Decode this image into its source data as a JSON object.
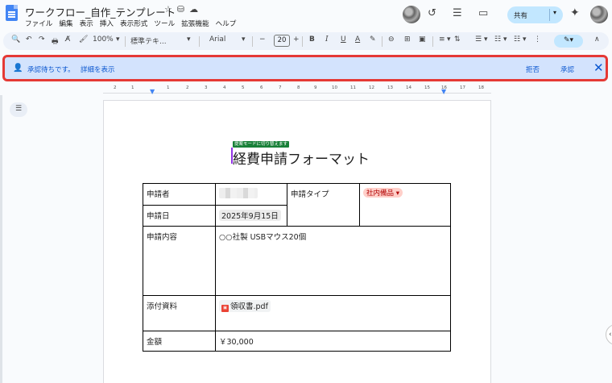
{
  "header": {
    "doc_title": "ワークフロー_自作_テンプレート",
    "title_icons": [
      "☆",
      "⛁",
      "☁"
    ],
    "menu": [
      "ファイル",
      "編集",
      "表示",
      "挿入",
      "表示形式",
      "ツール",
      "拡張機能",
      "ヘルプ"
    ],
    "share_label": "共有",
    "icons": {
      "history": "↺",
      "comments": "☰",
      "meet": "▭",
      "gemini": "✦"
    }
  },
  "toolbar": {
    "search": "🔍",
    "undo": "↶",
    "redo": "↷",
    "print": "🖶",
    "spell": "A̸",
    "paint": "🖌",
    "zoom": "100%",
    "style": "標準テキ...",
    "font": "Arial",
    "font_size": "20",
    "minus": "−",
    "plus": "+",
    "bold": "B",
    "italic": "I",
    "underline": "U",
    "text_color": "A",
    "highlight": "✎",
    "link": "⊖",
    "comment": "⊞",
    "image": "▣",
    "align": "≡",
    "line_spacing": "⇅",
    "checklist": "☰",
    "bullets": "☷",
    "numbering": "☷",
    "more": "⋮",
    "edit_mode": "✎▾",
    "collapse": "∧"
  },
  "approval": {
    "icon": "👤",
    "message": "承認待ちです。",
    "detail_link": "詳細を表示",
    "reject": "拒否",
    "approve": "承認",
    "close": "✕"
  },
  "ruler": {
    "ticks": [
      "2",
      "1",
      "1",
      "2",
      "3",
      "4",
      "5",
      "6",
      "7",
      "8",
      "9",
      "10",
      "11",
      "12",
      "13",
      "14",
      "15",
      "16",
      "17",
      "18"
    ]
  },
  "outline_icon": "☰",
  "document": {
    "mode_tag": "提案モードに切り替えます",
    "heading": "経費申請フォーマット",
    "rows": {
      "applicant_label": "申請者",
      "type_label": "申請タイプ",
      "type_value": "社内備品 ▾",
      "date_label": "申請日",
      "date_value": "2025年9月15日",
      "content_label": "申請内容",
      "content_value": "○○社製 USBマウス20個",
      "attachment_label": "添付資料",
      "attachment_value": "領収書.pdf",
      "amount_label": "金額",
      "amount_value": "￥30,000"
    }
  },
  "side_handle": "‹",
  "colors": {
    "accent_blue": "#0b57d0",
    "banner_bg": "#d3e3fd",
    "highlight_border": "#e53935",
    "tag_green": "#188038",
    "chip_red_bg": "#ffcfc9"
  }
}
